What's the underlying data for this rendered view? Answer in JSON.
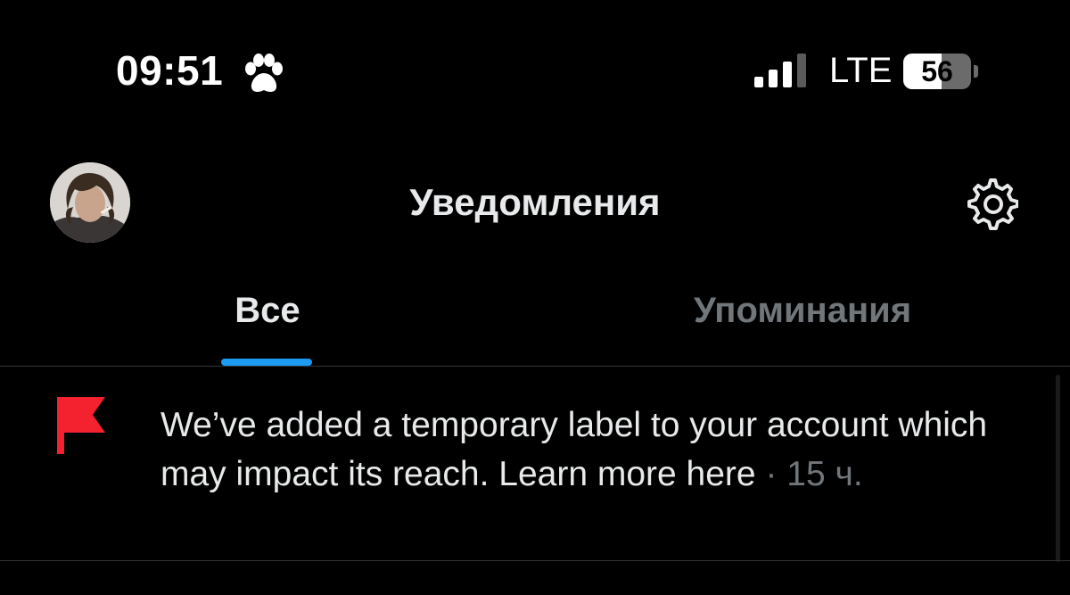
{
  "status_bar": {
    "time": "09:51",
    "network": "LTE",
    "battery_level": "56",
    "battery_fraction": 0.56,
    "icons": [
      "paw-icon",
      "signal-icon",
      "battery-icon"
    ]
  },
  "header": {
    "title": "Уведомления",
    "avatar_icon": "avatar",
    "settings_icon": "gear-icon"
  },
  "tabs": [
    {
      "label": "Все",
      "selected": true
    },
    {
      "label": "Упоминания",
      "selected": false
    }
  ],
  "colors": {
    "accent": "#1d9bf0",
    "flag": "#f4212e",
    "muted": "#71767b"
  },
  "notification": {
    "icon": "flag-icon",
    "text": "We’ve added a temporary label to your account which may impact its reach. Learn more here",
    "separator": " · ",
    "time": "15 ч."
  }
}
